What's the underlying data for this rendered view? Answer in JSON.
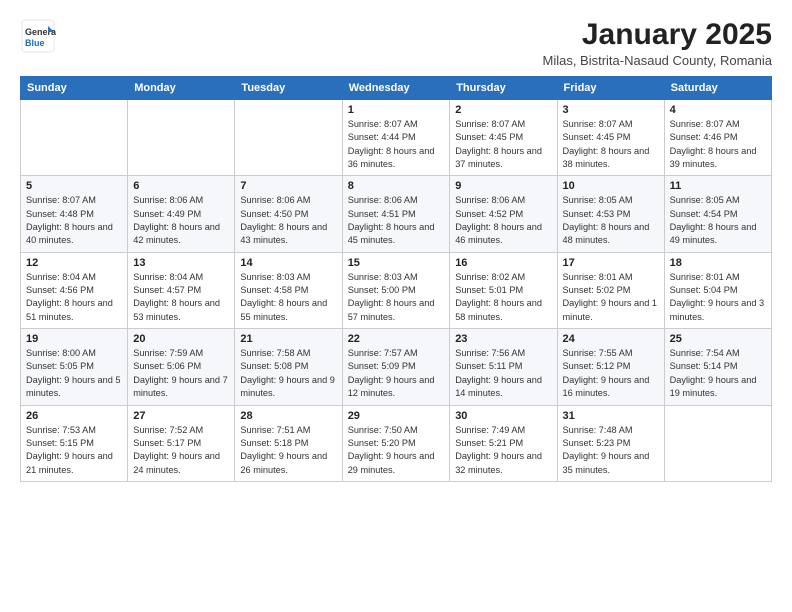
{
  "logo": {
    "general": "General",
    "blue": "Blue"
  },
  "title": "January 2025",
  "subtitle": "Milas, Bistrita-Nasaud County, Romania",
  "weekdays": [
    "Sunday",
    "Monday",
    "Tuesday",
    "Wednesday",
    "Thursday",
    "Friday",
    "Saturday"
  ],
  "weeks": [
    [
      {
        "day": "",
        "info": ""
      },
      {
        "day": "",
        "info": ""
      },
      {
        "day": "",
        "info": ""
      },
      {
        "day": "1",
        "info": "Sunrise: 8:07 AM\nSunset: 4:44 PM\nDaylight: 8 hours and 36 minutes."
      },
      {
        "day": "2",
        "info": "Sunrise: 8:07 AM\nSunset: 4:45 PM\nDaylight: 8 hours and 37 minutes."
      },
      {
        "day": "3",
        "info": "Sunrise: 8:07 AM\nSunset: 4:45 PM\nDaylight: 8 hours and 38 minutes."
      },
      {
        "day": "4",
        "info": "Sunrise: 8:07 AM\nSunset: 4:46 PM\nDaylight: 8 hours and 39 minutes."
      }
    ],
    [
      {
        "day": "5",
        "info": "Sunrise: 8:07 AM\nSunset: 4:48 PM\nDaylight: 8 hours and 40 minutes."
      },
      {
        "day": "6",
        "info": "Sunrise: 8:06 AM\nSunset: 4:49 PM\nDaylight: 8 hours and 42 minutes."
      },
      {
        "day": "7",
        "info": "Sunrise: 8:06 AM\nSunset: 4:50 PM\nDaylight: 8 hours and 43 minutes."
      },
      {
        "day": "8",
        "info": "Sunrise: 8:06 AM\nSunset: 4:51 PM\nDaylight: 8 hours and 45 minutes."
      },
      {
        "day": "9",
        "info": "Sunrise: 8:06 AM\nSunset: 4:52 PM\nDaylight: 8 hours and 46 minutes."
      },
      {
        "day": "10",
        "info": "Sunrise: 8:05 AM\nSunset: 4:53 PM\nDaylight: 8 hours and 48 minutes."
      },
      {
        "day": "11",
        "info": "Sunrise: 8:05 AM\nSunset: 4:54 PM\nDaylight: 8 hours and 49 minutes."
      }
    ],
    [
      {
        "day": "12",
        "info": "Sunrise: 8:04 AM\nSunset: 4:56 PM\nDaylight: 8 hours and 51 minutes."
      },
      {
        "day": "13",
        "info": "Sunrise: 8:04 AM\nSunset: 4:57 PM\nDaylight: 8 hours and 53 minutes."
      },
      {
        "day": "14",
        "info": "Sunrise: 8:03 AM\nSunset: 4:58 PM\nDaylight: 8 hours and 55 minutes."
      },
      {
        "day": "15",
        "info": "Sunrise: 8:03 AM\nSunset: 5:00 PM\nDaylight: 8 hours and 57 minutes."
      },
      {
        "day": "16",
        "info": "Sunrise: 8:02 AM\nSunset: 5:01 PM\nDaylight: 8 hours and 58 minutes."
      },
      {
        "day": "17",
        "info": "Sunrise: 8:01 AM\nSunset: 5:02 PM\nDaylight: 9 hours and 1 minute."
      },
      {
        "day": "18",
        "info": "Sunrise: 8:01 AM\nSunset: 5:04 PM\nDaylight: 9 hours and 3 minutes."
      }
    ],
    [
      {
        "day": "19",
        "info": "Sunrise: 8:00 AM\nSunset: 5:05 PM\nDaylight: 9 hours and 5 minutes."
      },
      {
        "day": "20",
        "info": "Sunrise: 7:59 AM\nSunset: 5:06 PM\nDaylight: 9 hours and 7 minutes."
      },
      {
        "day": "21",
        "info": "Sunrise: 7:58 AM\nSunset: 5:08 PM\nDaylight: 9 hours and 9 minutes."
      },
      {
        "day": "22",
        "info": "Sunrise: 7:57 AM\nSunset: 5:09 PM\nDaylight: 9 hours and 12 minutes."
      },
      {
        "day": "23",
        "info": "Sunrise: 7:56 AM\nSunset: 5:11 PM\nDaylight: 9 hours and 14 minutes."
      },
      {
        "day": "24",
        "info": "Sunrise: 7:55 AM\nSunset: 5:12 PM\nDaylight: 9 hours and 16 minutes."
      },
      {
        "day": "25",
        "info": "Sunrise: 7:54 AM\nSunset: 5:14 PM\nDaylight: 9 hours and 19 minutes."
      }
    ],
    [
      {
        "day": "26",
        "info": "Sunrise: 7:53 AM\nSunset: 5:15 PM\nDaylight: 9 hours and 21 minutes."
      },
      {
        "day": "27",
        "info": "Sunrise: 7:52 AM\nSunset: 5:17 PM\nDaylight: 9 hours and 24 minutes."
      },
      {
        "day": "28",
        "info": "Sunrise: 7:51 AM\nSunset: 5:18 PM\nDaylight: 9 hours and 26 minutes."
      },
      {
        "day": "29",
        "info": "Sunrise: 7:50 AM\nSunset: 5:20 PM\nDaylight: 9 hours and 29 minutes."
      },
      {
        "day": "30",
        "info": "Sunrise: 7:49 AM\nSunset: 5:21 PM\nDaylight: 9 hours and 32 minutes."
      },
      {
        "day": "31",
        "info": "Sunrise: 7:48 AM\nSunset: 5:23 PM\nDaylight: 9 hours and 35 minutes."
      },
      {
        "day": "",
        "info": ""
      }
    ]
  ]
}
